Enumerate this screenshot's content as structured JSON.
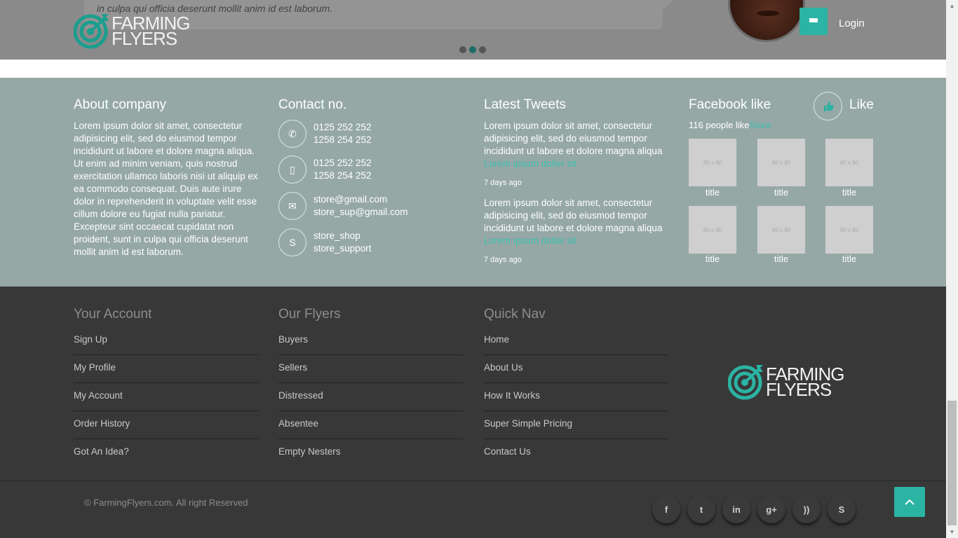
{
  "header": {
    "testimonial_text": "in culpa qui officia deserunt mollit anim id est laborum.",
    "login_label": "Login",
    "logo_line1": "FARMING",
    "logo_line2": "FLYERS",
    "slider_dots": 3,
    "active_dot": 2
  },
  "about": {
    "title": "About company",
    "text": "Lorem ipsum dolor sit amet, consectetur adipisicing elit, sed do eiusmod tempor incididunt ut labore et dolore magna aliqua. Ut enim ad minim veniam, quis nostrud exercitation ullamco laboris nisi ut aliquip ex ea commodo consequat. Duis aute irure dolor in reprehenderit in voluptate velit esse cillum dolore eu fugiat nulla pariatur. Excepteur sint occaecat cupidatat non proident, sunt in culpa qui officia deserunt mollit anim id est laborum."
  },
  "contact": {
    "title": "Contact no.",
    "items": [
      {
        "icon": "phone-icon",
        "line1": "0125 252 252",
        "line2": "1258 254 252"
      },
      {
        "icon": "mobile-icon",
        "line1": "0125 252 252",
        "line2": "1258 254 252"
      },
      {
        "icon": "envelope-icon",
        "line1": "store@gmail.com",
        "line2": "store_sup@gmail.com"
      },
      {
        "icon": "skype-icon",
        "line1": "store_shop",
        "line2": "store_support"
      }
    ]
  },
  "tweets": {
    "title": "Latest Tweets",
    "items": [
      {
        "text": "Lorem ipsum dolor sit amet, consectetur adipisicing elit, sed do eiusmod tempor incididunt ut labore et dolore magna aliqua",
        "link": "Lorem ipsum doller sit",
        "time": "7 days ago"
      },
      {
        "text": "Lorem ipsum dolor sit amet, consectetur adipisicing elit, sed do eiusmod tempor incididunt ut labore et dolore magna aliqua",
        "link": "Lorem ipsum doller sit",
        "time": "7 days ago"
      }
    ]
  },
  "facebook": {
    "title": "Facebook like",
    "like_label": "Like",
    "people_text": "116 people like",
    "people_link": "Store",
    "thumb_placeholder": "80 x 80",
    "thumb_titles": [
      "title",
      "title",
      "title",
      "title",
      "title",
      "title"
    ]
  },
  "footer": {
    "columns": [
      {
        "title": "Your Account",
        "links": [
          "Sign Up",
          "My Profile",
          "My Account",
          "Order History",
          "Got An Idea?"
        ]
      },
      {
        "title": "Our Flyers",
        "links": [
          "Buyers",
          "Sellers",
          "Distressed",
          "Absentee",
          "Empty Nesters"
        ]
      },
      {
        "title": "Quick Nav",
        "links": [
          "Home",
          "About Us",
          "How It Works",
          "Super Simple Pricing",
          "Contact Us"
        ]
      }
    ],
    "logo_line1": "FARMING",
    "logo_line2": "FLYERS",
    "copyright": "© FarmingFlyers.com. All right Reserved",
    "social": [
      {
        "name": "facebook-icon",
        "glyph": "f"
      },
      {
        "name": "twitter-icon",
        "glyph": "t"
      },
      {
        "name": "linkedin-icon",
        "glyph": "in"
      },
      {
        "name": "googleplus-icon",
        "glyph": "g+"
      },
      {
        "name": "rss-icon",
        "glyph": "))"
      },
      {
        "name": "skype-icon",
        "glyph": "S"
      }
    ],
    "totop_glyph": "︿"
  },
  "colors": {
    "accent": "#2bb3a3",
    "info_bg": "#96a8a6",
    "footer_bg": "#383838",
    "link": "#3bbfae"
  }
}
